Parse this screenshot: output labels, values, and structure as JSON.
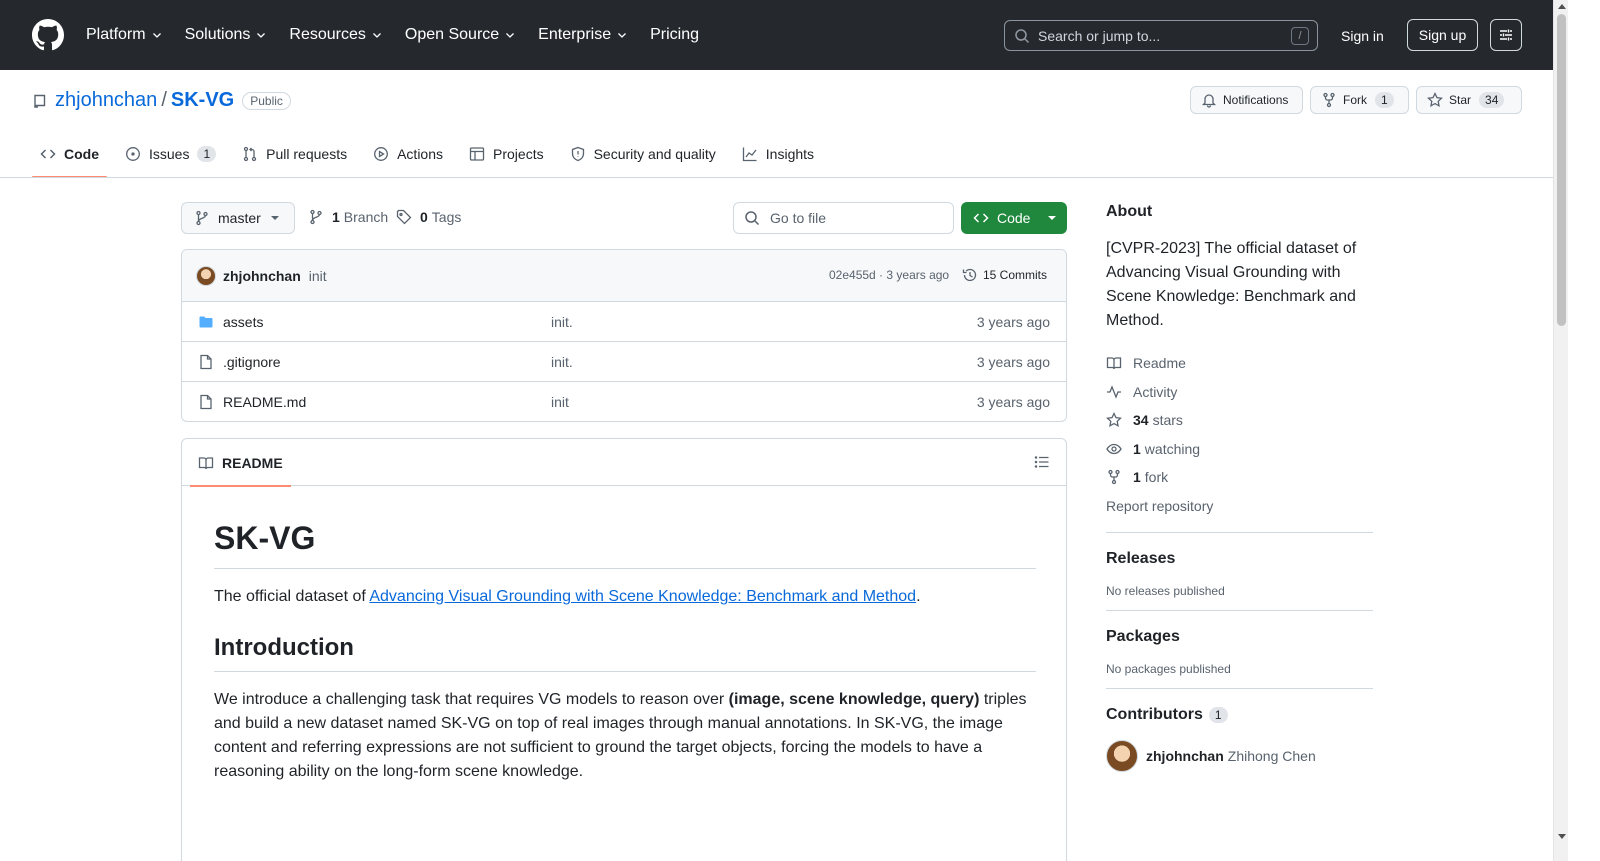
{
  "header": {
    "nav": [
      "Platform",
      "Solutions",
      "Resources",
      "Open Source",
      "Enterprise"
    ],
    "pricing": "Pricing",
    "search_placeholder": "Search or jump to...",
    "search_key": "/",
    "sign_in": "Sign in",
    "sign_up": "Sign up"
  },
  "repo": {
    "owner": "zhjohnchan",
    "separator": "/",
    "name": "SK-VG",
    "visibility": "Public",
    "notifications_label": "Notifications",
    "fork_label": "Fork",
    "fork_count": "1",
    "star_label": "Star",
    "star_count": "34"
  },
  "tabs": [
    {
      "label": "Code",
      "icon": "code-icon",
      "active": true
    },
    {
      "label": "Issues",
      "icon": "issue-icon",
      "count": "1"
    },
    {
      "label": "Pull requests",
      "icon": "pull-request-icon"
    },
    {
      "label": "Actions",
      "icon": "play-icon"
    },
    {
      "label": "Projects",
      "icon": "table-icon"
    },
    {
      "label": "Security and quality",
      "icon": "shield-icon"
    },
    {
      "label": "Insights",
      "icon": "graph-icon"
    }
  ],
  "browser": {
    "branch": "master",
    "branches_count": "1",
    "branches_label": "Branch",
    "tags_count": "0",
    "tags_label": "Tags",
    "goto_placeholder": "Go to file",
    "code_button": "Code"
  },
  "commit": {
    "author": "zhjohnchan",
    "message": "init",
    "hash_time": "02e455d · 3 years ago",
    "commits_label": "15 Commits"
  },
  "files": [
    {
      "name": "assets",
      "type": "folder",
      "message": "init.",
      "date": "3 years ago"
    },
    {
      "name": ".gitignore",
      "type": "file",
      "message": "init.",
      "date": "3 years ago"
    },
    {
      "name": "README.md",
      "type": "file",
      "message": "init",
      "date": "3 years ago"
    }
  ],
  "readme": {
    "tab_label": "README",
    "h1": "SK-VG",
    "intro_prefix": "The official dataset of ",
    "intro_link": "Advancing Visual Grounding with Scene Knowledge: Benchmark and Method",
    "intro_suffix": ".",
    "h2": "Introduction",
    "para_prefix": "We introduce a challenging task that requires VG models to reason over ",
    "para_bold": "(image, scene knowledge, query)",
    "para_suffix": " triples and build a new dataset named SK-VG on top of real images through manual annotations. In SK-VG, the image content and referring expressions are not sufficient to ground the target objects, forcing the models to have a reasoning ability on the long-form scene knowledge."
  },
  "sidebar": {
    "about_title": "About",
    "about_text": "[CVPR-2023] The official dataset of Advancing Visual Grounding with Scene Knowledge: Benchmark and Method.",
    "readme": "Readme",
    "activity": "Activity",
    "stars_count": "34",
    "stars_label": "stars",
    "watching_count": "1",
    "watching_label": "watching",
    "fork_count": "1",
    "fork_label": "fork",
    "report": "Report repository",
    "releases_title": "Releases",
    "releases_text": "No releases published",
    "packages_title": "Packages",
    "packages_text": "No packages published",
    "contributors_title": "Contributors",
    "contributors_count": "1",
    "contributor_login": "zhjohnchan",
    "contributor_name": "Zhihong Chen"
  }
}
